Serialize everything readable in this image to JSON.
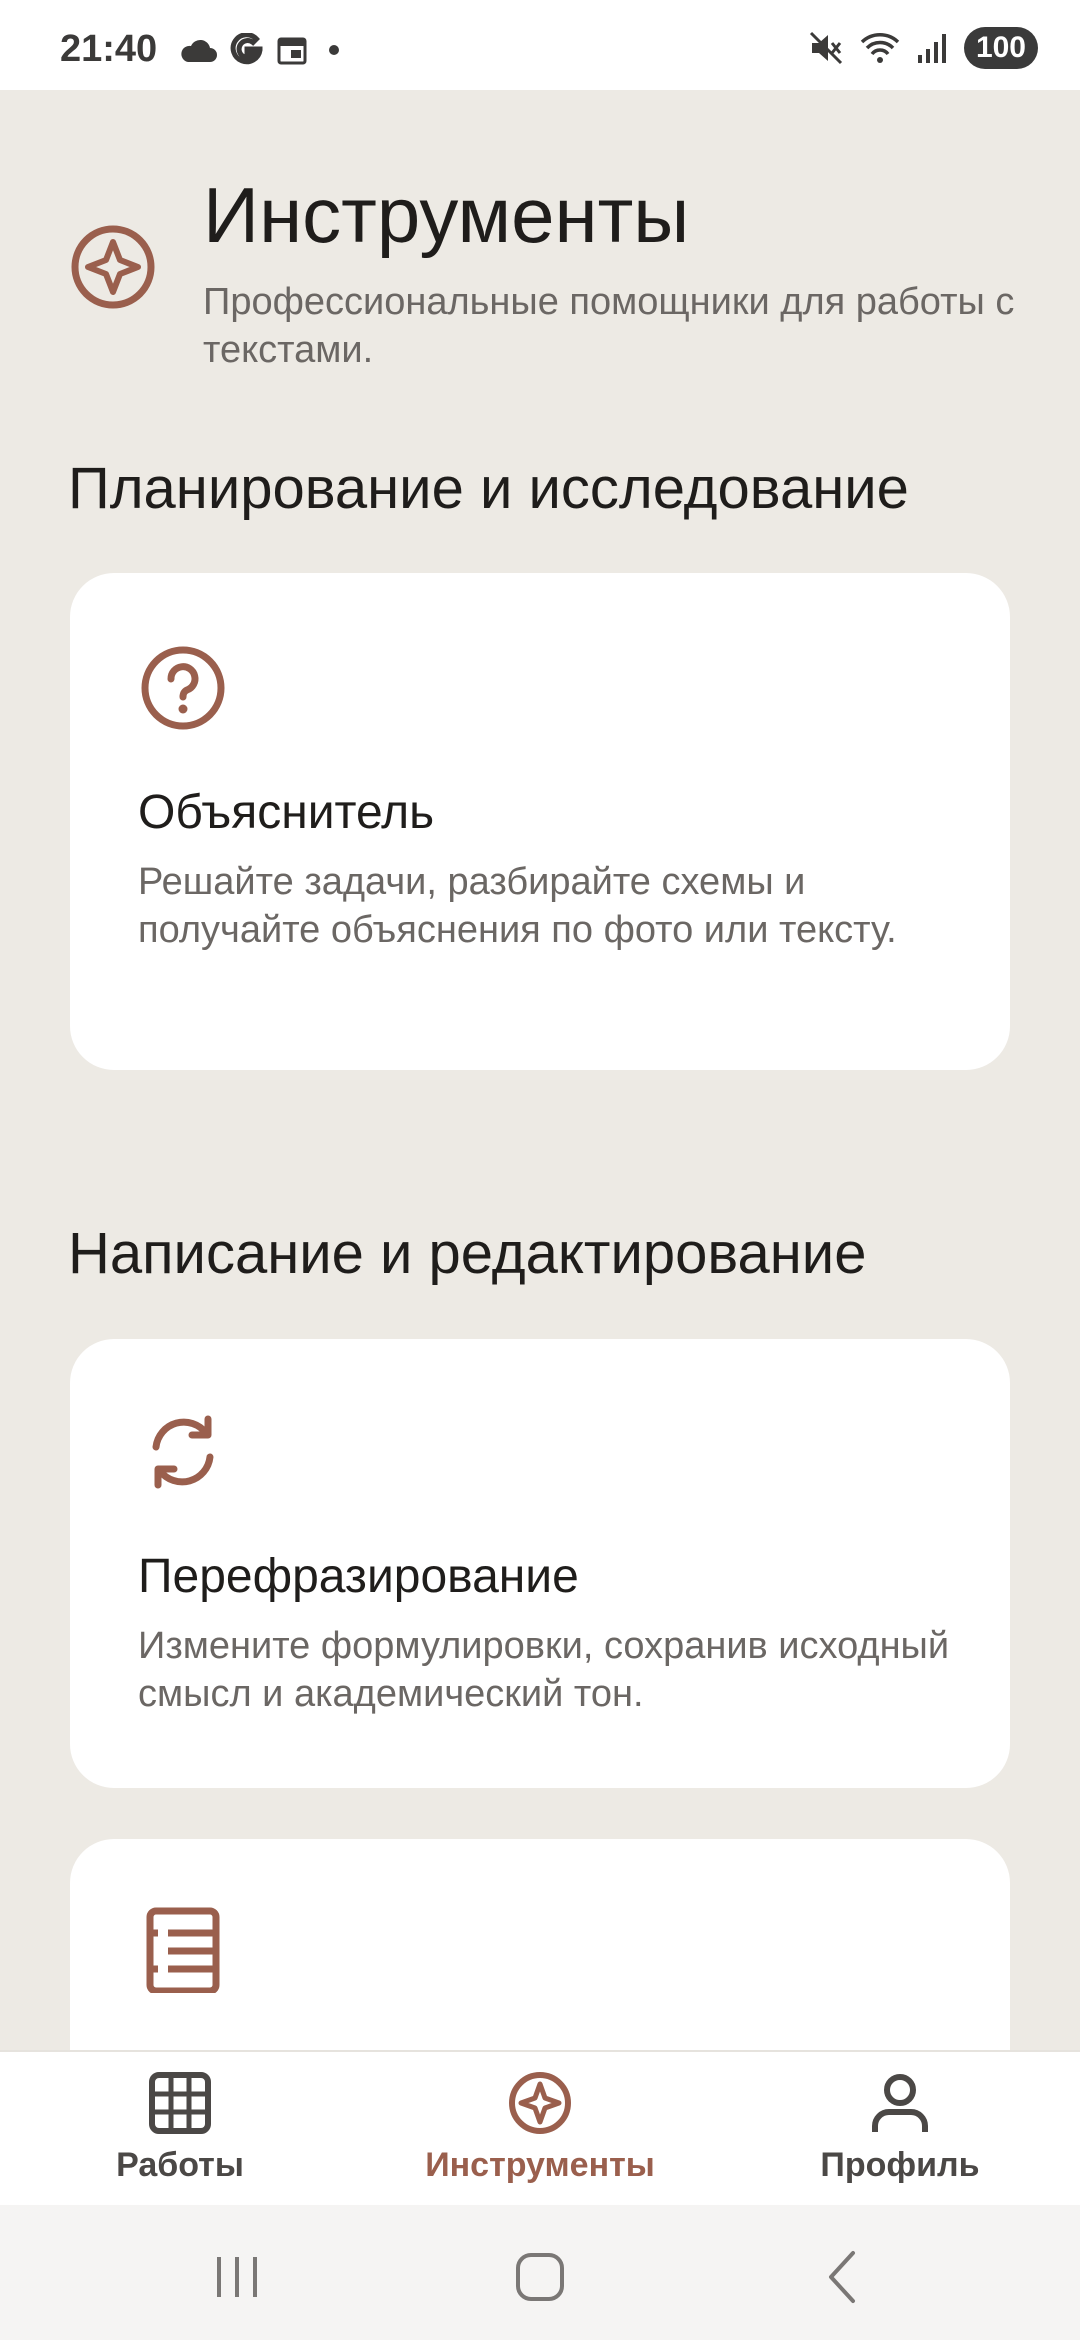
{
  "status_bar": {
    "time": "21:40",
    "left_icons": [
      "cloud-icon",
      "google-icon",
      "calendar-icon",
      "dot-icon"
    ],
    "right_icons": [
      "mute-icon",
      "wifi-icon",
      "signal-icon"
    ],
    "battery": "100"
  },
  "header": {
    "icon": "sparkle-compass-icon",
    "title": "Инструменты",
    "subtitle": "Профессиональные помощники для работы с текстами."
  },
  "sections": [
    {
      "title": "Планирование и исследование",
      "cards": [
        {
          "icon": "question-circle-icon",
          "title": "Объяснитель",
          "description": "Решайте задачи, разбирайте схемы и получайте объяснения по фото или тексту."
        }
      ]
    },
    {
      "title": "Написание и редактирование",
      "cards": [
        {
          "icon": "refresh-icon",
          "title": "Перефразирование",
          "description": "Измените формулировки, сохранив исходный смысл и академический тон."
        },
        {
          "icon": "document-lines-icon",
          "title": "",
          "description": ""
        }
      ]
    }
  ],
  "bottom_nav": {
    "items": [
      {
        "label": "Работы",
        "icon": "grid-icon",
        "active": false
      },
      {
        "label": "Инструменты",
        "icon": "sparkle-compass-icon",
        "active": true
      },
      {
        "label": "Профиль",
        "icon": "person-icon",
        "active": false
      }
    ]
  },
  "system_nav": [
    "recents-icon",
    "home-icon",
    "back-icon"
  ],
  "colors": {
    "accent": "#9a5f4d",
    "background": "#edeae4",
    "card": "#ffffff",
    "text_primary": "#1f1d1b",
    "text_secondary": "#6b6764"
  }
}
